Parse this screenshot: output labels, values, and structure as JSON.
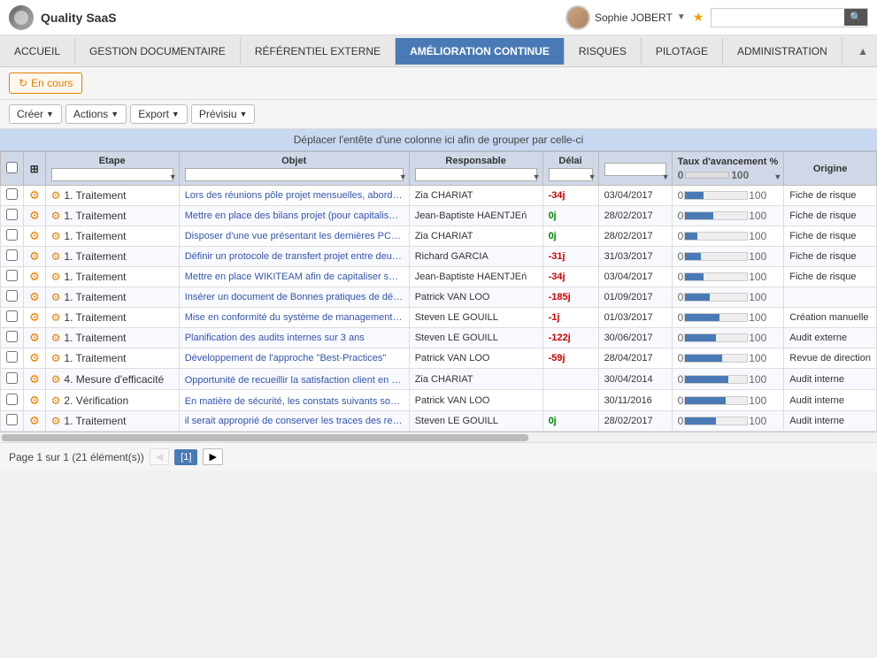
{
  "app": {
    "logo_text": "Quality SaaS",
    "user_name": "Sophie JOBERT",
    "search_placeholder": ""
  },
  "nav": {
    "items": [
      {
        "label": "ACCUEIL",
        "active": false
      },
      {
        "label": "GESTION DOCUMENTAIRE",
        "active": false
      },
      {
        "label": "RÉFÉRENTIEL EXTERNE",
        "active": false
      },
      {
        "label": "AMÉLIORATION CONTINUE",
        "active": true
      },
      {
        "label": "RISQUES",
        "active": false
      },
      {
        "label": "PILOTAGE",
        "active": false
      },
      {
        "label": "ADMINISTRATION",
        "active": false
      }
    ]
  },
  "tabs": [
    {
      "label": "En cours",
      "active": true
    }
  ],
  "toolbar": {
    "creer_label": "Créer",
    "actions_label": "Actions",
    "export_label": "Export",
    "previsu_label": "Prévisiu"
  },
  "group_header": "Déplacer l'entête d'une colonne ici afin de grouper par celle-ci",
  "table": {
    "columns": [
      "",
      "",
      "Etape",
      "Objet",
      "Responsable",
      "Délai",
      "",
      "Taux d'avancement %",
      "Origine"
    ],
    "rows": [
      {
        "etape": "1. Traitement",
        "objet": "Lors des réunions pôle projet mensuelles, aborder les c",
        "responsable": "Zia CHARIAT",
        "delai": "-34j",
        "date": "03/04/2017",
        "progress": 30,
        "origine": "Fiche de risque",
        "delai_class": "red"
      },
      {
        "etape": "1. Traitement",
        "objet": "Mettre en place des bilans projet (pour capitaliser sur le",
        "responsable": "Jean-Baptiste HAENTJEń",
        "delai": "0j",
        "date": "28/02/2017",
        "progress": 45,
        "origine": "Fiche de risque",
        "delai_class": "green"
      },
      {
        "etape": "1. Traitement",
        "objet": "Disposer d'une vue présentant les dernières PCM publi",
        "responsable": "Zia CHARIAT",
        "delai": "0j",
        "date": "28/02/2017",
        "progress": 20,
        "origine": "Fiche de risque",
        "delai_class": "green"
      },
      {
        "etape": "1. Traitement",
        "objet": "Définir un protocole de transfert projet entre deux DPs",
        "responsable": "Richard GARCIA",
        "delai": "-31j",
        "date": "31/03/2017",
        "progress": 25,
        "origine": "Fiche de risque",
        "delai_class": "red"
      },
      {
        "etape": "1. Traitement",
        "objet": "Mettre en place WIKITEAM afin de capitaliser sur les c",
        "responsable": "Jean-Baptiste HAENTJEń",
        "delai": "-34j",
        "date": "03/04/2017",
        "progress": 30,
        "origine": "Fiche de risque",
        "delai_class": "red"
      },
      {
        "etape": "1. Traitement",
        "objet": "Insérer un document de Bonnes pratiques de développp",
        "responsable": "Patrick VAN LOO",
        "delai": "-185j",
        "date": "01/09/2017",
        "progress": 40,
        "origine": "",
        "delai_class": "red"
      },
      {
        "etape": "1. Traitement",
        "objet": "Mise en conformité du système de management aux n",
        "responsable": "Steven LE GOUILL",
        "delai": "-1j",
        "date": "01/03/2017",
        "progress": 55,
        "origine": "Création manuelle",
        "delai_class": "red"
      },
      {
        "etape": "1. Traitement",
        "objet": "Planification des audits internes sur 3 ans",
        "responsable": "Steven LE GOUILL",
        "delai": "-122j",
        "date": "30/06/2017",
        "progress": 50,
        "origine": "Audit externe",
        "delai_class": "red"
      },
      {
        "etape": "1. Traitement",
        "objet": "Développement de l'approche \"Best-Practices\"",
        "responsable": "Patrick VAN LOO",
        "delai": "-59j",
        "date": "28/04/2017",
        "progress": 60,
        "origine": "Revue de direction",
        "delai_class": "red"
      },
      {
        "etape": "4. Mesure d'efficacité",
        "objet": "Opportunité de recueillir la satisfaction client en fin de",
        "responsable": "Zia CHARIAT",
        "delai": "",
        "date": "30/04/2014",
        "progress": 70,
        "origine": "Audit interne",
        "delai_class": "normal",
        "search_icon": true
      },
      {
        "etape": "2. Vérification",
        "objet": "En matière de sécurité, les constats suivants sont form",
        "responsable": "Patrick VAN LOO",
        "delai": "",
        "date": "30/11/2016",
        "progress": 65,
        "origine": "Audit interne",
        "delai_class": "normal",
        "search_icon": true
      },
      {
        "etape": "1. Traitement",
        "objet": "il serait approprié de conserver les traces des restaurat",
        "responsable": "Steven LE GOUILL",
        "delai": "0j",
        "date": "28/02/2017",
        "progress": 50,
        "origine": "Audit interne",
        "delai_class": "green"
      }
    ]
  },
  "pagination": {
    "text": "Page 1 sur 1 (21 élément(s))",
    "pages": [
      "[1]"
    ]
  }
}
